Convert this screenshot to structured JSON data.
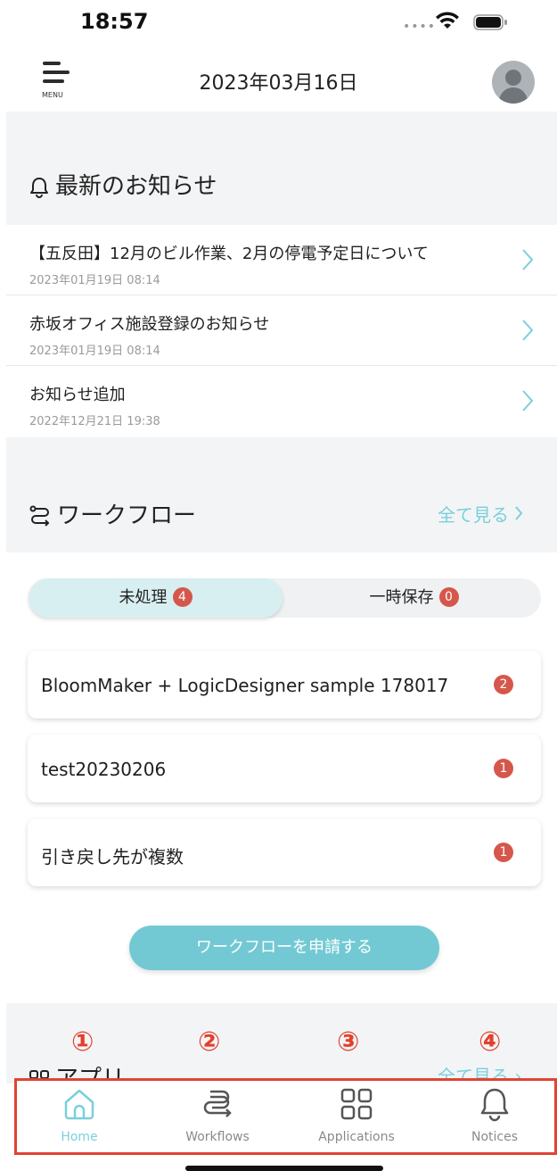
{
  "status_bar": {
    "time": "18:57"
  },
  "header": {
    "menu_label": "MENU",
    "date": "2023年03月16日"
  },
  "notices": {
    "title": "最新のお知らせ",
    "items": [
      {
        "title": "【五反田】12月のビル作業、2月の停電予定日について",
        "date": "2023年01月19日 08:14"
      },
      {
        "title": "赤坂オフィス施設登録のお知らせ",
        "date": "2023年01月19日 08:14"
      },
      {
        "title": "お知らせ追加",
        "date": "2022年12月21日 19:38"
      }
    ]
  },
  "workflow": {
    "title": "ワークフロー",
    "see_all": "全て見る",
    "tabs": [
      {
        "label": "未処理",
        "count": "4",
        "active": true
      },
      {
        "label": "一時保存",
        "count": "0",
        "active": false
      }
    ],
    "items": [
      {
        "name": "BloomMaker + LogicDesigner sample 178017",
        "count": "2"
      },
      {
        "name": "test20230206",
        "count": "1"
      },
      {
        "name": "引き戻し先が複数",
        "count": "1"
      }
    ],
    "apply_button": "ワークフローを申請する"
  },
  "apps": {
    "title": "アプリ",
    "see_all": "全て見る"
  },
  "markers": [
    "①",
    "②",
    "③",
    "④"
  ],
  "tabbar": {
    "items": [
      {
        "label": "Home",
        "icon": "home-icon",
        "active": true
      },
      {
        "label": "Workflows",
        "icon": "workflow-icon",
        "active": false
      },
      {
        "label": "Applications",
        "icon": "grid-icon",
        "active": false
      },
      {
        "label": "Notices",
        "icon": "bell-icon",
        "active": false
      }
    ]
  },
  "colors": {
    "accent": "#79d0db",
    "badge": "#d5574b",
    "highlight": "#e04432"
  }
}
